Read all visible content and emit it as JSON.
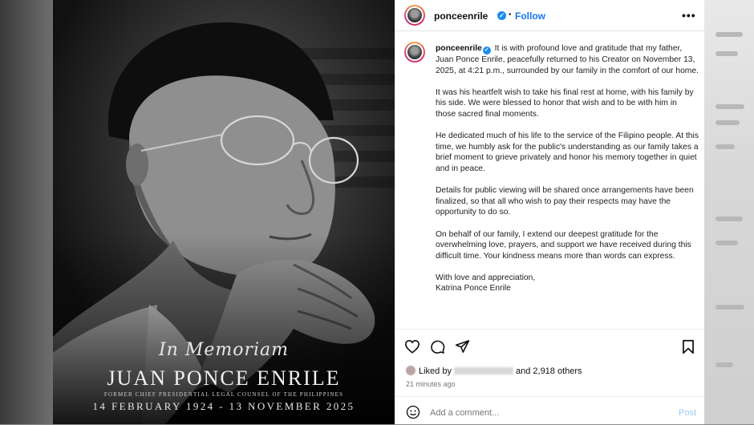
{
  "post": {
    "username": "ponceenrile",
    "separator": "•",
    "follow_label": "Follow",
    "more_label": "•••",
    "verified_glyph": "✓",
    "caption_paragraphs": [
      "It is with profound love and gratitude that my father, Juan Ponce Enrile, peacefully returned to his Creator on November 13, 2025, at 4:21 p.m., surrounded by our family in the comfort of our home.",
      "It was his heartfelt wish to take his final rest at home, with his family by his side. We were blessed to honor that wish and to be with him in those sacred final moments.",
      "He dedicated much of his life to the service of the Filipino people. At this time, we humbly ask for the public's understanding as our family takes a brief moment to grieve privately and honor his memory together in quiet and in peace.",
      "Details for public viewing will be shared once arrangements have been finalized, so that all who wish to pay their respects may have the opportunity to do so.",
      "On behalf of our family, I extend our deepest gratitude for the overwhelming love, prayers, and support we have received during this difficult time. Your kindness means more than words can express.",
      "With love and appreciation,",
      "Katrina Ponce Enrile"
    ],
    "likes": {
      "prefix": "Liked by",
      "suffix": "and 2,918 others"
    },
    "time_ago": "21 minutes ago",
    "comment_placeholder": "Add a comment...",
    "post_button": "Post",
    "icons": [
      "heart-icon",
      "comment-icon",
      "share-icon",
      "bookmark-icon",
      "emoji-icon"
    ]
  },
  "memorial_card": {
    "script_title": "In Memoriam",
    "name": "JUAN PONCE ENRILE",
    "role": "FORMER CHIEF PRESIDENTIAL LEGAL COUNSEL OF THE PHILIPPINES",
    "dates": "14 FEBRUARY 1924 - 13 NOVEMBER 2025"
  },
  "colors": {
    "accent": "#1877f2",
    "verified": "#1a8cf0",
    "photo_bg": "#1b1b1b"
  }
}
